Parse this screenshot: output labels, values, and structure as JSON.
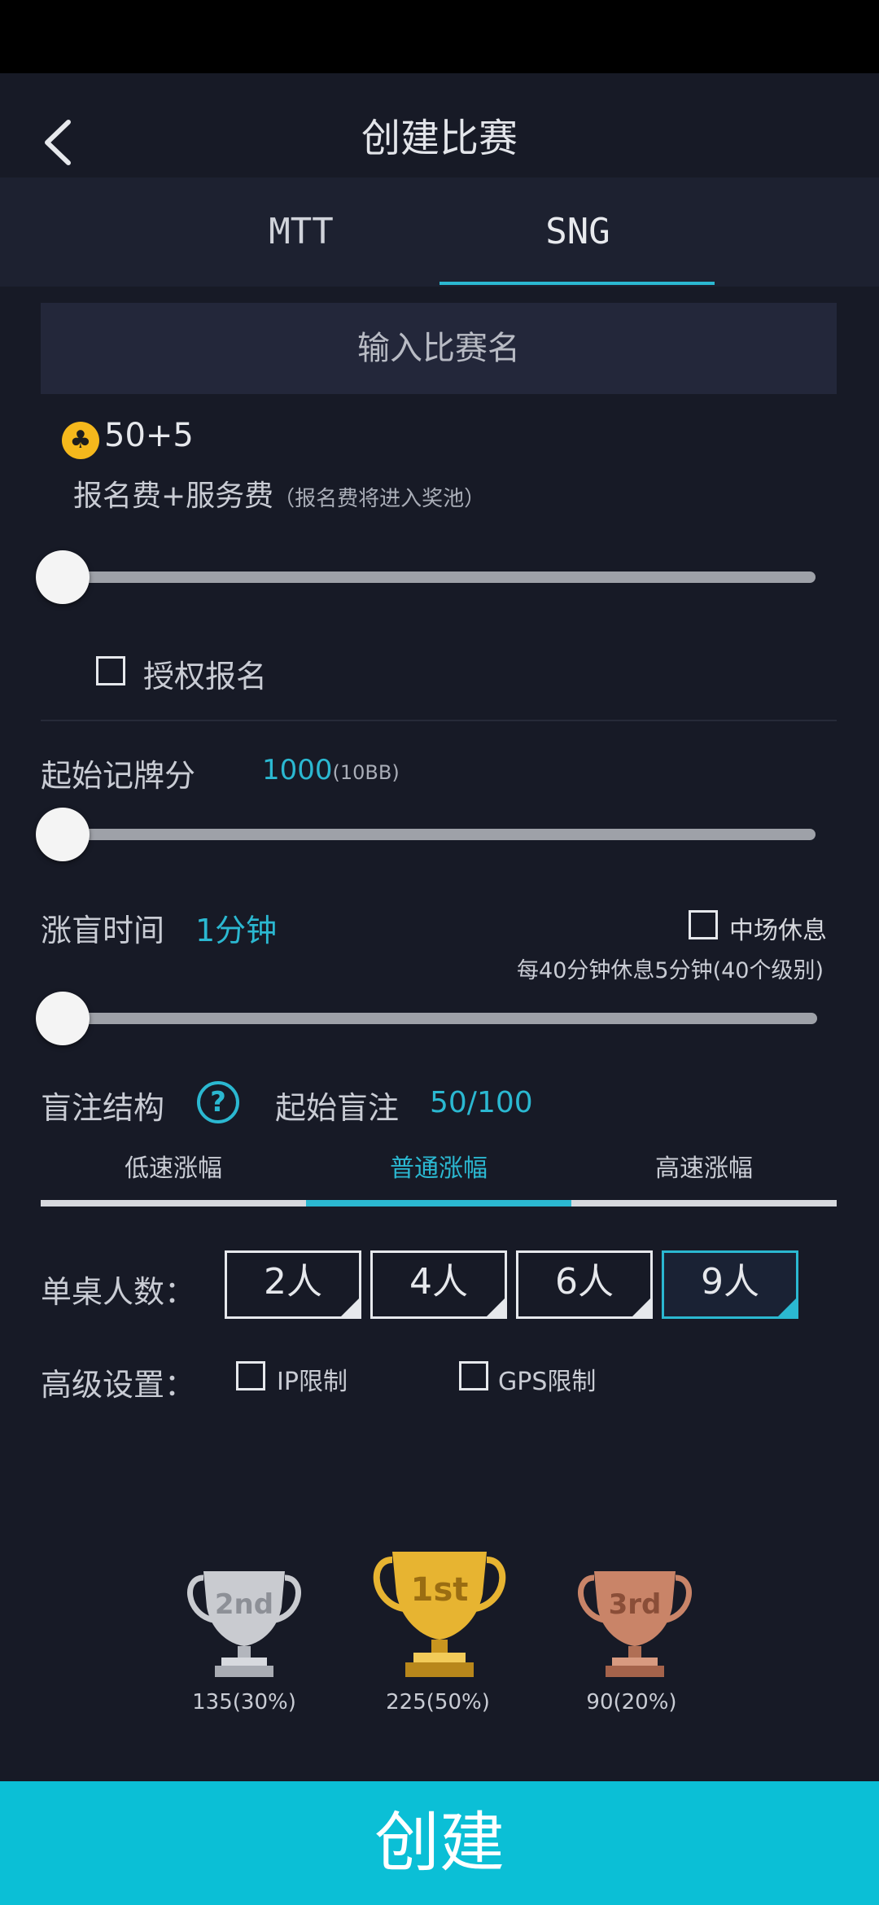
{
  "header": {
    "title": "创建比赛"
  },
  "tabs": [
    {
      "label": "MTT"
    },
    {
      "label": "SNG"
    }
  ],
  "match_name": {
    "placeholder": "输入比赛名"
  },
  "fee": {
    "value": "50+5",
    "label": "报名费+服务费",
    "note": "（报名费将进入奖池）",
    "slider_position": 0
  },
  "authorize": {
    "label": "授权报名",
    "checked": false
  },
  "starting_chips": {
    "label": "起始记牌分",
    "value": "1000",
    "note": "(10BB)",
    "slider_position": 0
  },
  "blind_time": {
    "label": "涨盲时间",
    "value": "1分钟",
    "break_label": "中场休息",
    "break_note": "每40分钟休息5分钟(40个级别)",
    "slider_position": 0
  },
  "blind_structure": {
    "label": "盲注结构",
    "start_blind_label": "起始盲注",
    "start_blind_value": "50/100",
    "options": [
      "低速涨幅",
      "普通涨幅",
      "高速涨幅"
    ],
    "selected_index": 1
  },
  "seats": {
    "label": "单桌人数：",
    "options": [
      "2人",
      "4人",
      "6人",
      "9人"
    ],
    "selected_index": 3
  },
  "advanced": {
    "label": "高级设置：",
    "ip_limit": "IP限制",
    "gps_limit": "GPS限制"
  },
  "prizes": [
    {
      "rank_text": "2nd",
      "amount": "135(30%)"
    },
    {
      "rank_text": "1st",
      "amount": "225(50%)"
    },
    {
      "rank_text": "3rd",
      "amount": "90(20%)"
    }
  ],
  "create_button": "创建",
  "colors": {
    "accent": "#2bb8d1",
    "background": "#171a26",
    "create_button": "#0bbfd6",
    "gold": "#e7b431",
    "silver": "#c9cbd0",
    "bronze": "#c98468"
  }
}
